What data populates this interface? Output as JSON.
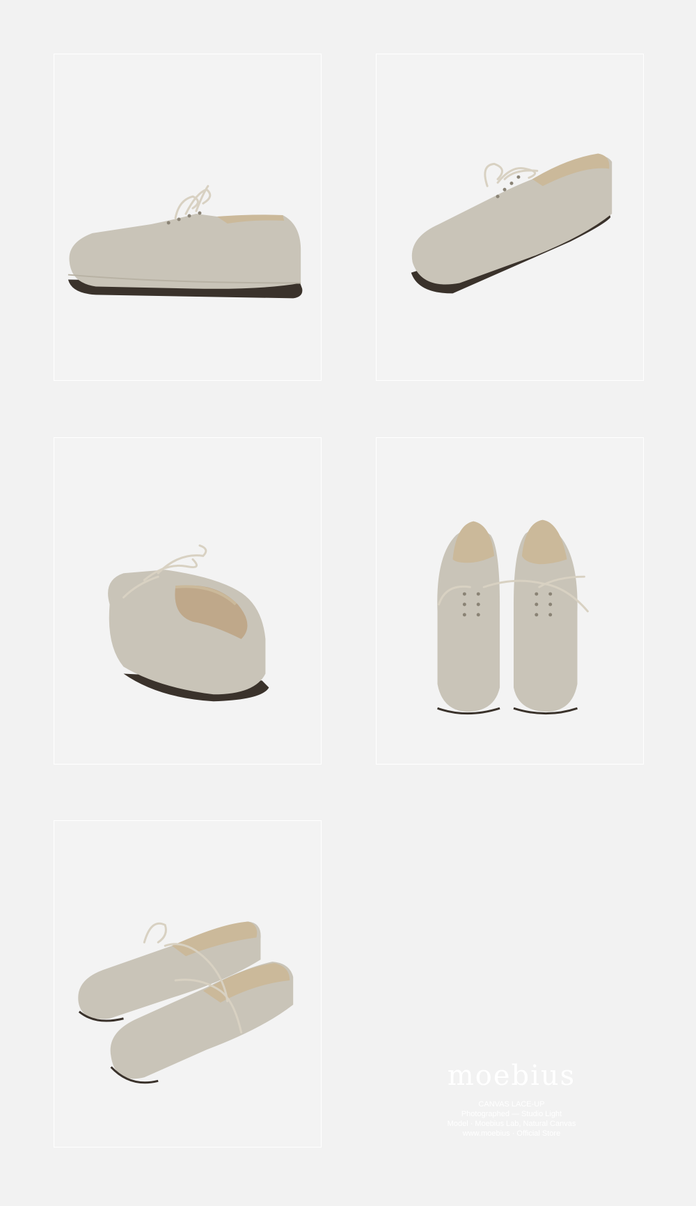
{
  "panels": [
    {
      "id": "side-view",
      "label": ""
    },
    {
      "id": "three-quarter-front",
      "label": ""
    },
    {
      "id": "rear-three-quarter",
      "label": ""
    },
    {
      "id": "top-pair",
      "label": ""
    },
    {
      "id": "angled-pair",
      "label": ""
    }
  ],
  "brand": {
    "name": "moebius",
    "lines": [
      "CANVAS LACE-UP",
      "Photographed — Studio Light",
      "Model · Moebius Lab, Natural Canvas",
      "www.moebius · Official Store"
    ]
  },
  "colors": {
    "background": "#f2f2f2",
    "canvas": "#c9c4b8",
    "lining": "#cbb99a",
    "sole": "#3a322b",
    "lace": "#d8d1c2"
  }
}
